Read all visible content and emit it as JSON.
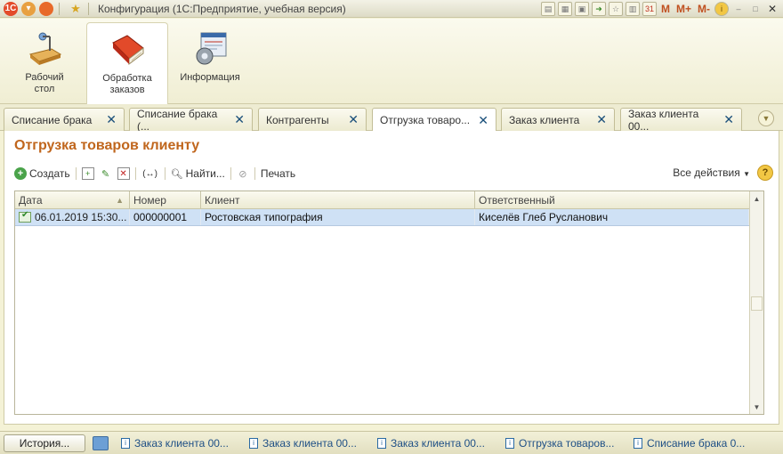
{
  "window": {
    "title": "Конфигурация  (1С:Предприятие, учебная версия)",
    "right_labels": [
      "M",
      "M+",
      "M-"
    ]
  },
  "sections": [
    {
      "label": "Рабочий стол",
      "icon": "desk-icon"
    },
    {
      "label": "Обработка заказов",
      "icon": "order-book-icon"
    },
    {
      "label": "Информация",
      "icon": "info-gear-icon"
    }
  ],
  "tabs": [
    {
      "label": "Списание брака"
    },
    {
      "label": "Списание брака (..."
    },
    {
      "label": "Контрагенты"
    },
    {
      "label": "Отгрузка товаро..."
    },
    {
      "label": "Заказ клиента"
    },
    {
      "label": "Заказ клиента 00..."
    }
  ],
  "form": {
    "title": "Отгрузка товаров клиенту",
    "toolbar": {
      "create": "Создать",
      "find": "Найти...",
      "print": "Печать",
      "all_actions": "Все действия"
    },
    "table": {
      "columns": [
        "Дата",
        "Номер",
        "Клиент",
        "Ответственный"
      ],
      "rows": [
        {
          "date": "06.01.2019 15:30...",
          "number": "000000001",
          "client": "Ростовская типография",
          "responsible": "Киселёв Глеб Русланович"
        }
      ]
    }
  },
  "bottom": {
    "history": "История...",
    "open_windows": [
      "Заказ клиента 00...",
      "Заказ клиента 00...",
      "Заказ клиента 00...",
      "Отгрузка товаров...",
      "Списание брака 0..."
    ]
  },
  "colors": {
    "accent_title": "#c0661d",
    "selection": "#cfe1f5",
    "link": "#1e4f85"
  }
}
